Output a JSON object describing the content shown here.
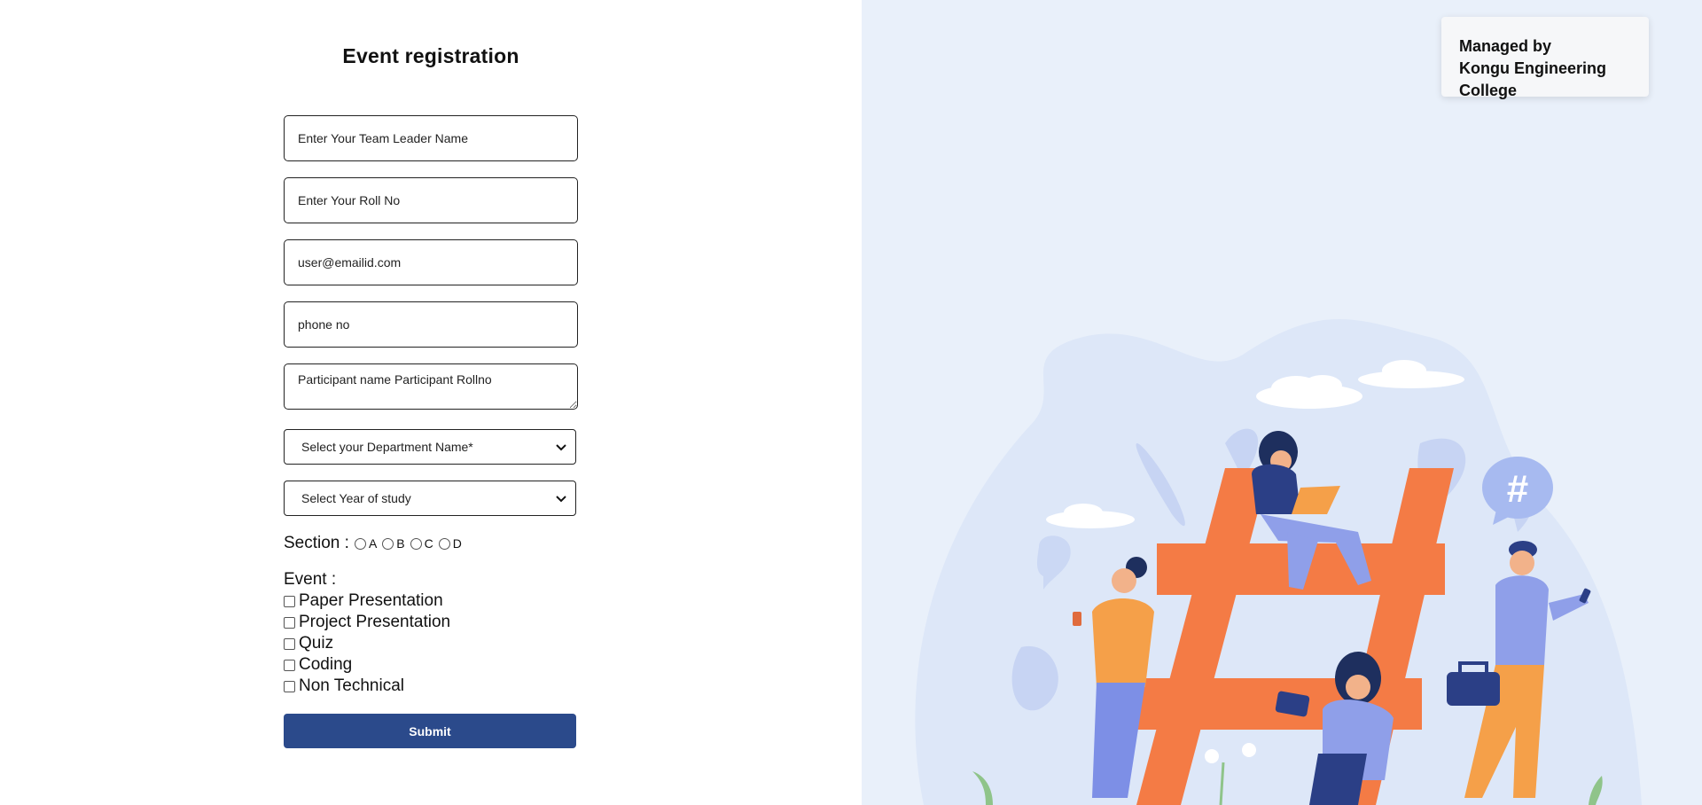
{
  "form": {
    "title": "Event registration",
    "leader_placeholder": "Enter Your Team Leader Name",
    "rollno_placeholder": "Enter Your Roll No",
    "email_placeholder": "user@emailid.com",
    "phone_placeholder": "phone no",
    "participants_placeholder": "Participant name Participant Rollno",
    "department_select": "Select your Department Name*",
    "year_select": "Select Year of study",
    "section_label": "Section :",
    "section_options": [
      "A",
      "B",
      "C",
      "D"
    ],
    "event_label": "Event :",
    "events": [
      "Paper Presentation",
      "Project Presentation",
      "Quiz",
      "Coding",
      "Non Technical"
    ],
    "submit_label": "Submit"
  },
  "managed": {
    "line1": "Managed by",
    "line2": "Kongu Engineering College"
  },
  "colors": {
    "accent": "#2b4a8b",
    "panel_bg": "#e9f0fa",
    "hashtag": "#f47b45"
  },
  "illustration": {
    "speech_bubble_text": "#"
  }
}
